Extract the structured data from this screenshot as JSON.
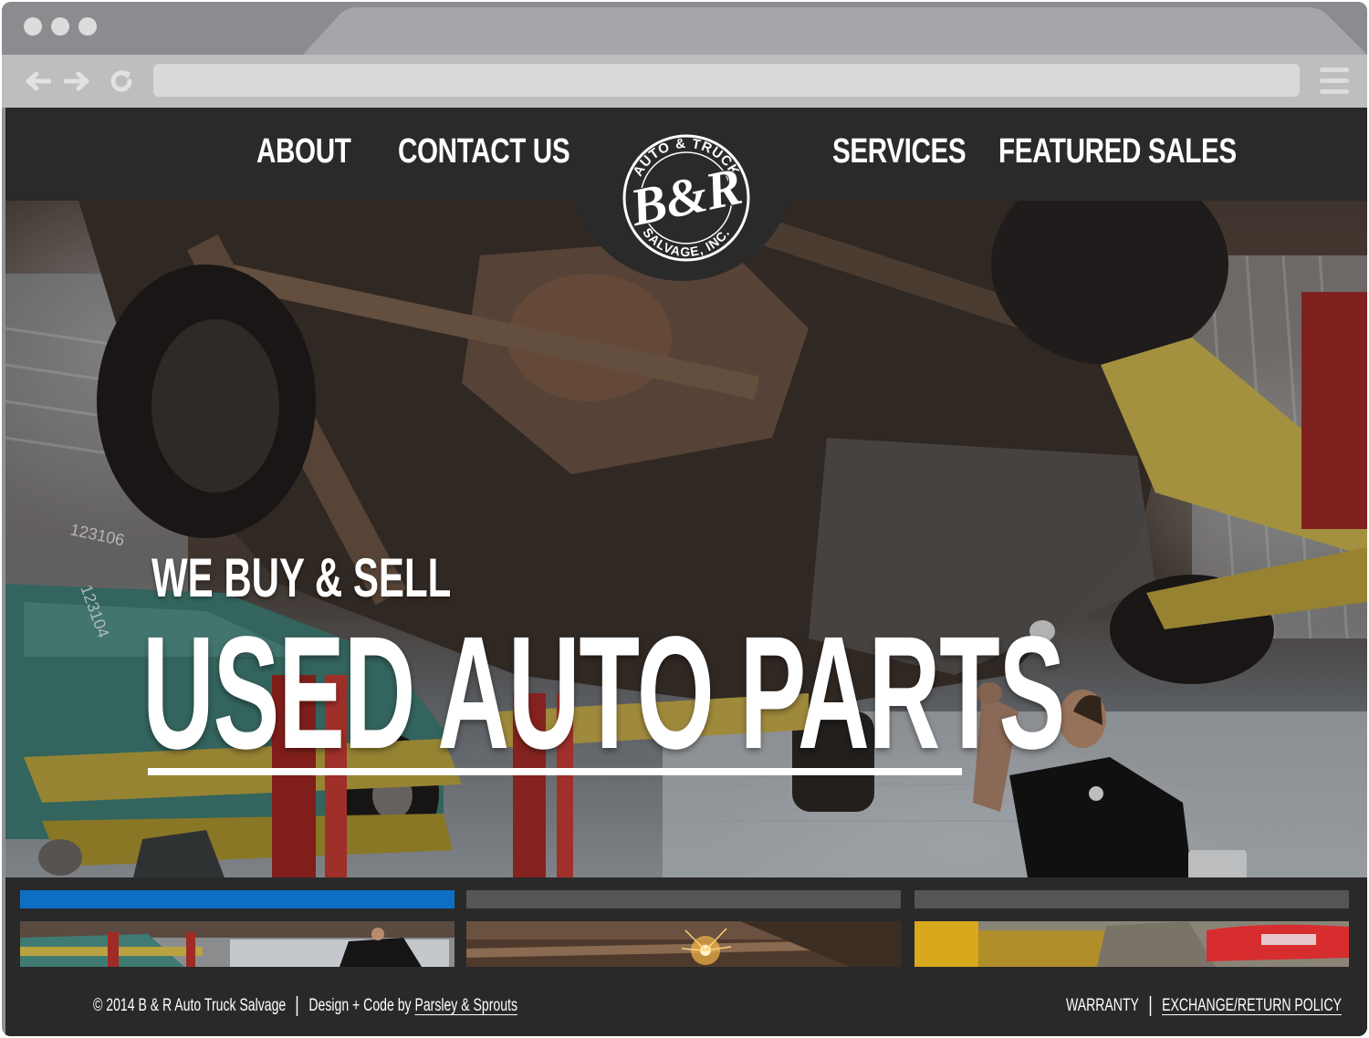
{
  "nav": {
    "about": "ABOUT",
    "contact": "CONTACT US",
    "services": "SERVICES",
    "featured": "FEATURED SALES"
  },
  "logo": {
    "top_arc": "AUTO & TRUCK",
    "main": "B&R",
    "bottom_arc": "SALVAGE, INC."
  },
  "hero": {
    "subtitle": "WE BUY & SELL",
    "title": "USED AUTO PARTS",
    "car_tag_1": "123106",
    "car_tag_2": "123104"
  },
  "slider": {
    "active_index": 0,
    "active_color": "#0d6fc1",
    "inactive_color": "#545557"
  },
  "footer": {
    "copyright": "© 2014 B & R Auto Truck Salvage",
    "credit_prefix": "Design + Code by ",
    "credit_link": "Parsley & Sprouts",
    "warranty": "WARRANTY",
    "exchange": "EXCHANGE/RETURN POLICY"
  }
}
